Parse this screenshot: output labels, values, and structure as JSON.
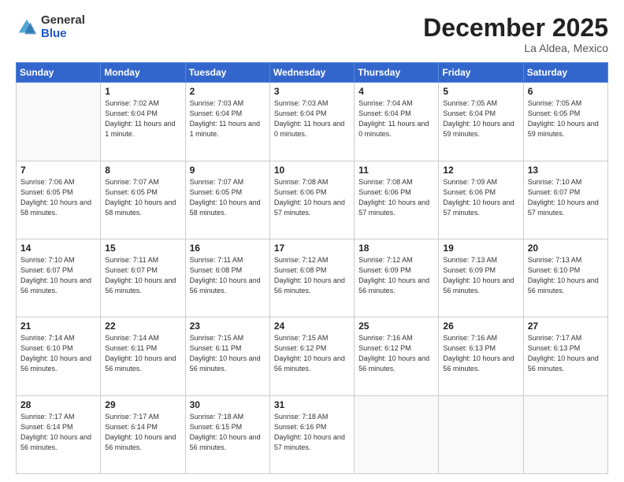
{
  "logo": {
    "general": "General",
    "blue": "Blue"
  },
  "header": {
    "month": "December 2025",
    "location": "La Aldea, Mexico"
  },
  "weekdays": [
    "Sunday",
    "Monday",
    "Tuesday",
    "Wednesday",
    "Thursday",
    "Friday",
    "Saturday"
  ],
  "weeks": [
    [
      {
        "day": "",
        "sunrise": "",
        "sunset": "",
        "daylight": ""
      },
      {
        "day": "1",
        "sunrise": "Sunrise: 7:02 AM",
        "sunset": "Sunset: 6:04 PM",
        "daylight": "Daylight: 11 hours and 1 minute."
      },
      {
        "day": "2",
        "sunrise": "Sunrise: 7:03 AM",
        "sunset": "Sunset: 6:04 PM",
        "daylight": "Daylight: 11 hours and 1 minute."
      },
      {
        "day": "3",
        "sunrise": "Sunrise: 7:03 AM",
        "sunset": "Sunset: 6:04 PM",
        "daylight": "Daylight: 11 hours and 0 minutes."
      },
      {
        "day": "4",
        "sunrise": "Sunrise: 7:04 AM",
        "sunset": "Sunset: 6:04 PM",
        "daylight": "Daylight: 11 hours and 0 minutes."
      },
      {
        "day": "5",
        "sunrise": "Sunrise: 7:05 AM",
        "sunset": "Sunset: 6:04 PM",
        "daylight": "Daylight: 10 hours and 59 minutes."
      },
      {
        "day": "6",
        "sunrise": "Sunrise: 7:05 AM",
        "sunset": "Sunset: 6:05 PM",
        "daylight": "Daylight: 10 hours and 59 minutes."
      }
    ],
    [
      {
        "day": "7",
        "sunrise": "Sunrise: 7:06 AM",
        "sunset": "Sunset: 6:05 PM",
        "daylight": "Daylight: 10 hours and 58 minutes."
      },
      {
        "day": "8",
        "sunrise": "Sunrise: 7:07 AM",
        "sunset": "Sunset: 6:05 PM",
        "daylight": "Daylight: 10 hours and 58 minutes."
      },
      {
        "day": "9",
        "sunrise": "Sunrise: 7:07 AM",
        "sunset": "Sunset: 6:05 PM",
        "daylight": "Daylight: 10 hours and 58 minutes."
      },
      {
        "day": "10",
        "sunrise": "Sunrise: 7:08 AM",
        "sunset": "Sunset: 6:06 PM",
        "daylight": "Daylight: 10 hours and 57 minutes."
      },
      {
        "day": "11",
        "sunrise": "Sunrise: 7:08 AM",
        "sunset": "Sunset: 6:06 PM",
        "daylight": "Daylight: 10 hours and 57 minutes."
      },
      {
        "day": "12",
        "sunrise": "Sunrise: 7:09 AM",
        "sunset": "Sunset: 6:06 PM",
        "daylight": "Daylight: 10 hours and 57 minutes."
      },
      {
        "day": "13",
        "sunrise": "Sunrise: 7:10 AM",
        "sunset": "Sunset: 6:07 PM",
        "daylight": "Daylight: 10 hours and 57 minutes."
      }
    ],
    [
      {
        "day": "14",
        "sunrise": "Sunrise: 7:10 AM",
        "sunset": "Sunset: 6:07 PM",
        "daylight": "Daylight: 10 hours and 56 minutes."
      },
      {
        "day": "15",
        "sunrise": "Sunrise: 7:11 AM",
        "sunset": "Sunset: 6:07 PM",
        "daylight": "Daylight: 10 hours and 56 minutes."
      },
      {
        "day": "16",
        "sunrise": "Sunrise: 7:11 AM",
        "sunset": "Sunset: 6:08 PM",
        "daylight": "Daylight: 10 hours and 56 minutes."
      },
      {
        "day": "17",
        "sunrise": "Sunrise: 7:12 AM",
        "sunset": "Sunset: 6:08 PM",
        "daylight": "Daylight: 10 hours and 56 minutes."
      },
      {
        "day": "18",
        "sunrise": "Sunrise: 7:12 AM",
        "sunset": "Sunset: 6:09 PM",
        "daylight": "Daylight: 10 hours and 56 minutes."
      },
      {
        "day": "19",
        "sunrise": "Sunrise: 7:13 AM",
        "sunset": "Sunset: 6:09 PM",
        "daylight": "Daylight: 10 hours and 56 minutes."
      },
      {
        "day": "20",
        "sunrise": "Sunrise: 7:13 AM",
        "sunset": "Sunset: 6:10 PM",
        "daylight": "Daylight: 10 hours and 56 minutes."
      }
    ],
    [
      {
        "day": "21",
        "sunrise": "Sunrise: 7:14 AM",
        "sunset": "Sunset: 6:10 PM",
        "daylight": "Daylight: 10 hours and 56 minutes."
      },
      {
        "day": "22",
        "sunrise": "Sunrise: 7:14 AM",
        "sunset": "Sunset: 6:11 PM",
        "daylight": "Daylight: 10 hours and 56 minutes."
      },
      {
        "day": "23",
        "sunrise": "Sunrise: 7:15 AM",
        "sunset": "Sunset: 6:11 PM",
        "daylight": "Daylight: 10 hours and 56 minutes."
      },
      {
        "day": "24",
        "sunrise": "Sunrise: 7:15 AM",
        "sunset": "Sunset: 6:12 PM",
        "daylight": "Daylight: 10 hours and 56 minutes."
      },
      {
        "day": "25",
        "sunrise": "Sunrise: 7:16 AM",
        "sunset": "Sunset: 6:12 PM",
        "daylight": "Daylight: 10 hours and 56 minutes."
      },
      {
        "day": "26",
        "sunrise": "Sunrise: 7:16 AM",
        "sunset": "Sunset: 6:13 PM",
        "daylight": "Daylight: 10 hours and 56 minutes."
      },
      {
        "day": "27",
        "sunrise": "Sunrise: 7:17 AM",
        "sunset": "Sunset: 6:13 PM",
        "daylight": "Daylight: 10 hours and 56 minutes."
      }
    ],
    [
      {
        "day": "28",
        "sunrise": "Sunrise: 7:17 AM",
        "sunset": "Sunset: 6:14 PM",
        "daylight": "Daylight: 10 hours and 56 minutes."
      },
      {
        "day": "29",
        "sunrise": "Sunrise: 7:17 AM",
        "sunset": "Sunset: 6:14 PM",
        "daylight": "Daylight: 10 hours and 56 minutes."
      },
      {
        "day": "30",
        "sunrise": "Sunrise: 7:18 AM",
        "sunset": "Sunset: 6:15 PM",
        "daylight": "Daylight: 10 hours and 56 minutes."
      },
      {
        "day": "31",
        "sunrise": "Sunrise: 7:18 AM",
        "sunset": "Sunset: 6:16 PM",
        "daylight": "Daylight: 10 hours and 57 minutes."
      },
      {
        "day": "",
        "sunrise": "",
        "sunset": "",
        "daylight": ""
      },
      {
        "day": "",
        "sunrise": "",
        "sunset": "",
        "daylight": ""
      },
      {
        "day": "",
        "sunrise": "",
        "sunset": "",
        "daylight": ""
      }
    ]
  ]
}
